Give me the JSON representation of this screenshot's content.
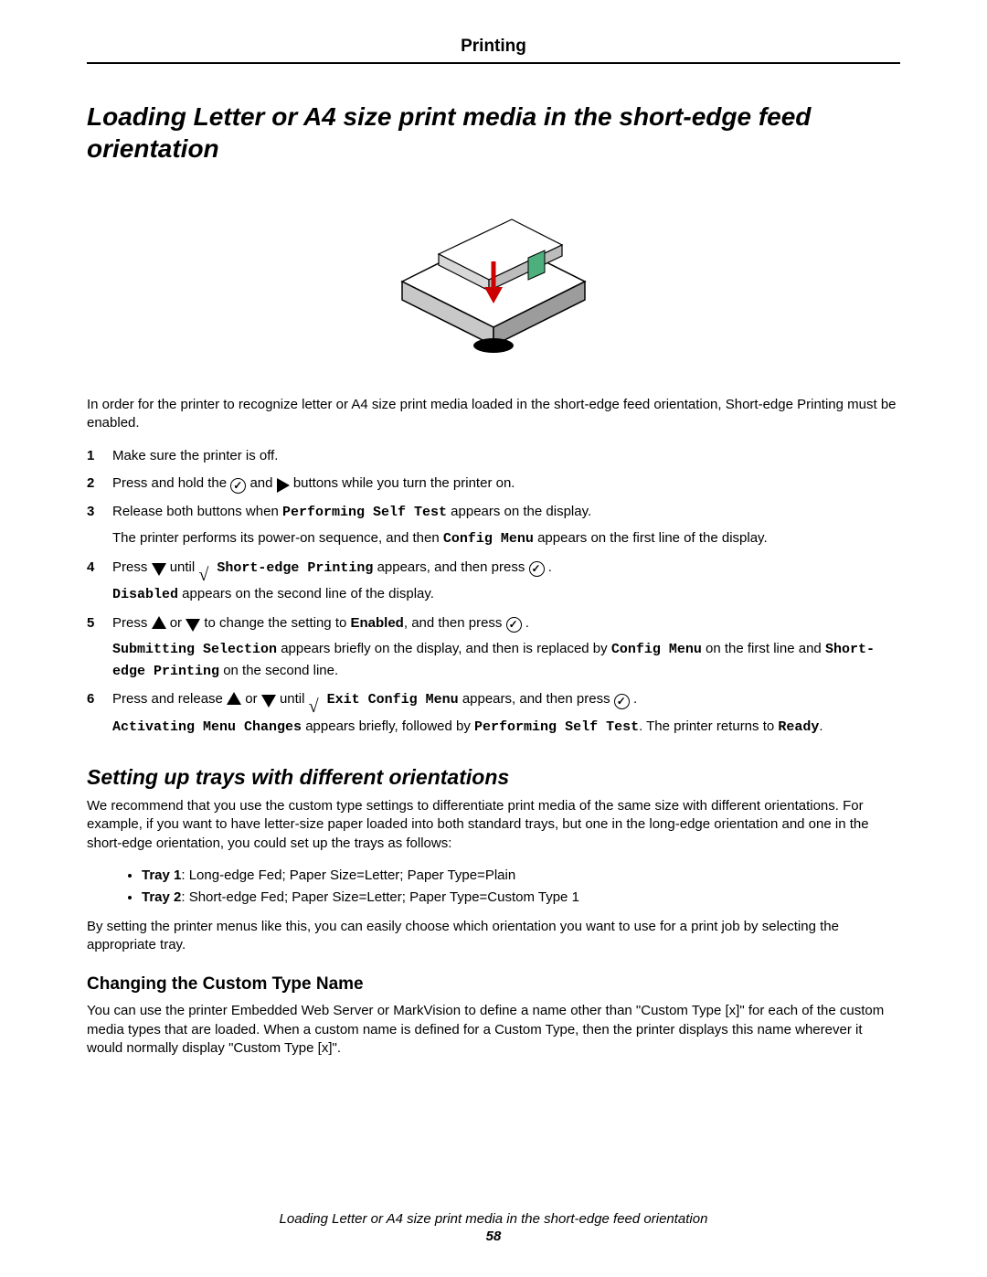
{
  "header": {
    "title": "Printing"
  },
  "h1": "Loading Letter or A4 size print media in the short-edge feed orientation",
  "intro": "In order for the printer to recognize letter or A4 size print media loaded in the short-edge feed orientation, Short-edge Printing must be enabled.",
  "steps": {
    "s1": {
      "num": "1",
      "text": "Make sure the printer is off."
    },
    "s2": {
      "num": "2",
      "a": "Press and hold the ",
      "b": " and ",
      "c": " buttons while you turn the printer on."
    },
    "s3": {
      "num": "3",
      "a": "Release both buttons when ",
      "code1": "Performing Self Test",
      "b": " appears on the display.",
      "sub_a": "The printer performs its power-on sequence, and then ",
      "code2": "Config Menu",
      "sub_b": " appears on the first line of the display."
    },
    "s4": {
      "num": "4",
      "a": "Press ",
      "b": " until ",
      "code1": " Short-edge Printing",
      "c": " appears, and then press ",
      "d": " .",
      "sub_code": "Disabled",
      "sub_text": " appears on the second line of the display."
    },
    "s5": {
      "num": "5",
      "a": "Press ",
      "b": " or ",
      "c": " to change the setting to ",
      "bold1": "Enabled",
      "d": ", and then press ",
      "e": " .",
      "sub_code1": "Submitting Selection",
      "sub_a": " appears briefly on the display, and then is replaced by ",
      "sub_code2": "Config Menu",
      "sub_b": " on the first line and ",
      "sub_code3": "Short-edge Printing",
      "sub_c": " on the second line."
    },
    "s6": {
      "num": "6",
      "a": "Press and release ",
      "b": " or ",
      "c": " until ",
      "code1": " Exit Config Menu",
      "d": " appears, and then press ",
      "e": " .",
      "sub_code1": "Activating Menu Changes",
      "sub_a": " appears briefly, followed by ",
      "sub_code2": "Performing Self Test",
      "sub_b": ". The printer returns to ",
      "sub_code3": "Ready",
      "sub_c": "."
    }
  },
  "h2": "Setting up trays with different orientations",
  "trays_intro": "We recommend that you use the custom type settings to differentiate print media of the same size with different orientations. For example, if you want to have letter-size paper loaded into both standard trays, but one in the long-edge orientation and one in the short-edge orientation, you could set up the trays as follows:",
  "tray1_label": "Tray 1",
  "tray1_text": ": Long-edge Fed; Paper Size=Letter; Paper Type=Plain",
  "tray2_label": "Tray 2",
  "tray2_text": ": Short-edge Fed; Paper Size=Letter; Paper Type=Custom Type 1",
  "trays_outro": "By setting the printer menus like this, you can easily choose which orientation you want to use for a print job by selecting the appropriate tray.",
  "h3": "Changing the Custom Type Name",
  "custom_text": "You can use the printer Embedded Web Server or MarkVision to define a name other than \"Custom Type [x]\" for each of the custom media types that are loaded. When a custom name is defined for a Custom Type, then the printer displays this name wherever it would normally display \"Custom Type [x]\".",
  "footer": {
    "caption": "Loading Letter or A4 size print media in the short-edge feed orientation",
    "page": "58"
  }
}
